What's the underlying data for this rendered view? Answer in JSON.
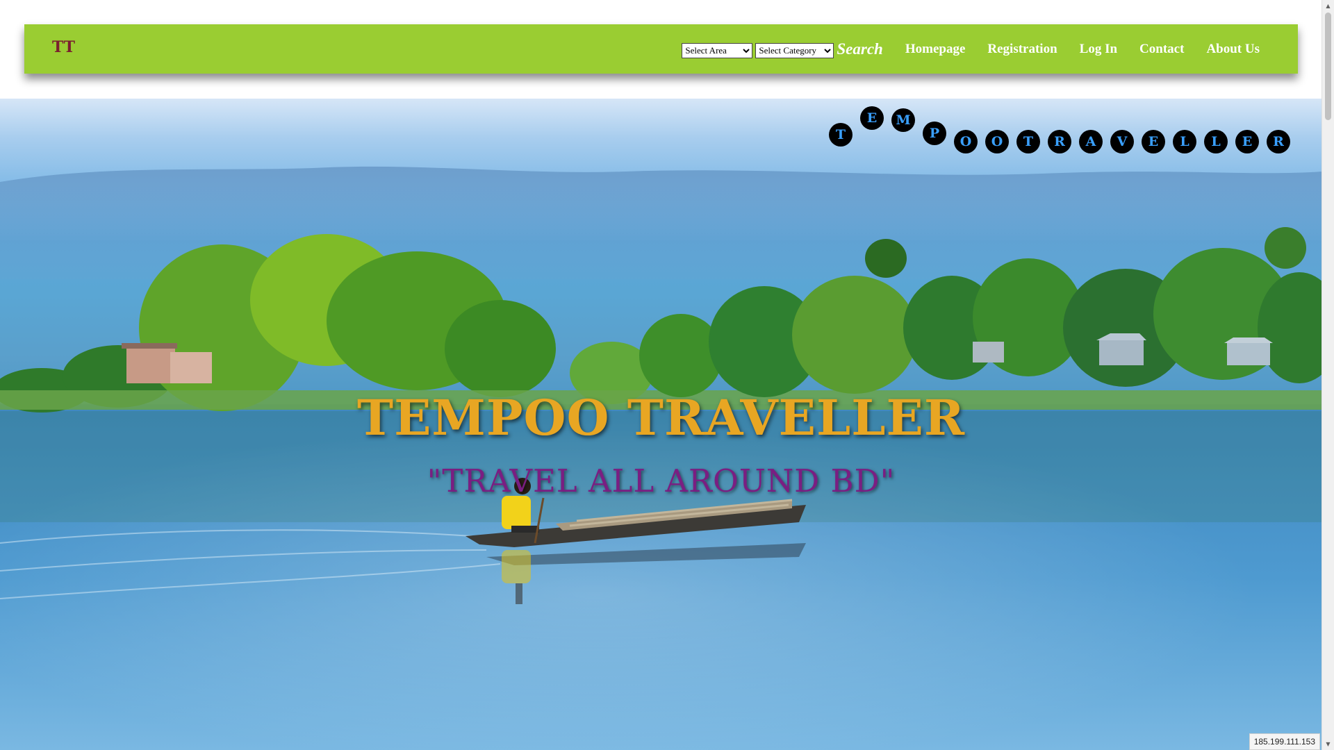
{
  "navbar": {
    "brand": "TT",
    "area_select": {
      "selected": "Select Area",
      "options": [
        "Select Area"
      ]
    },
    "category_select": {
      "selected": "Select Category",
      "options": [
        "Select Category"
      ]
    },
    "search_label": "Search",
    "links": [
      {
        "label": "Homepage"
      },
      {
        "label": "Registration"
      },
      {
        "label": "Log In"
      },
      {
        "label": "Contact"
      },
      {
        "label": "About Us"
      }
    ],
    "background_color": "#9acd32"
  },
  "hero": {
    "floating_letters": [
      "T",
      "E",
      "M",
      "P",
      "O",
      "O",
      "T",
      "R",
      "A",
      "V",
      "E",
      "L",
      "L",
      "E",
      "R"
    ],
    "title": "TEMPOO TRAVELLER",
    "tagline": "\"TRAVEL ALL AROUND BD\"",
    "title_color": "#e8a623",
    "tagline_color": "#7a1e82",
    "background_description_icon": "lake-boat-landscape-image"
  },
  "status_bar": {
    "url": "185.199.111.153"
  },
  "scrollbar": {
    "up_arrow": "▲",
    "down_arrow": "▼"
  }
}
